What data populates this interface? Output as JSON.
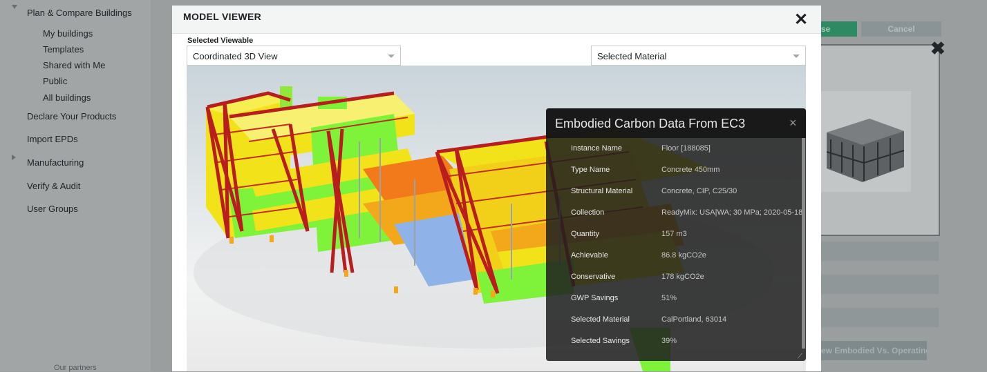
{
  "sidebar": {
    "section": "Plan & Compare Buildings",
    "sub_items": [
      {
        "label": "My buildings"
      },
      {
        "label": "Templates"
      },
      {
        "label": "Shared with Me"
      },
      {
        "label": "Public"
      },
      {
        "label": "All buildings"
      }
    ],
    "items": [
      {
        "label": "Declare Your Products"
      },
      {
        "label": "Import EPDs"
      },
      {
        "label": "Manufacturing"
      },
      {
        "label": "Verify & Audit"
      },
      {
        "label": "User Groups"
      }
    ],
    "footer": "Our partners"
  },
  "background": {
    "close_button_fragment": "se",
    "cancel_button": "Cancel",
    "bottom_button_fragment": "ew Embodied Vs. Operating"
  },
  "modal": {
    "title": "MODEL VIEWER",
    "close_symbol": "✕",
    "viewable_label": "Selected Viewable",
    "viewable_value": "Coordinated 3D View",
    "material_value": "Selected Material"
  },
  "ec3": {
    "title": "Embodied Carbon Data From EC3",
    "close_symbol": "×",
    "resize_symbol": "⟋",
    "rows": [
      {
        "label": "Instance Name",
        "value": "Floor [188085]"
      },
      {
        "label": "Type Name",
        "value": "Concrete 450mm"
      },
      {
        "label": "Structural Material",
        "value": "Concrete, CIP, C25/30"
      },
      {
        "label": "Collection",
        "value": "ReadyMix: USA|WA; 30 MPa; 2020-05-18"
      },
      {
        "label": "Quantity",
        "value": "157 m3"
      },
      {
        "label": "Achievable",
        "value": "86.8 kgCO2e"
      },
      {
        "label": "Conservative",
        "value": "178 kgCO2e"
      },
      {
        "label": "GWP Savings",
        "value": "51%"
      },
      {
        "label": "Selected Material",
        "value": "CalPortland, 63014"
      },
      {
        "label": "Selected Savings",
        "value": "39%"
      }
    ]
  },
  "colors": {
    "accent_green": "#2f8a64",
    "structure_red": "#b81e1e",
    "slab_yellow": "#f2e21a",
    "slab_green": "#7ff23a",
    "slab_orange": "#f27a1a",
    "slab_blue": "#8fb2e8"
  }
}
